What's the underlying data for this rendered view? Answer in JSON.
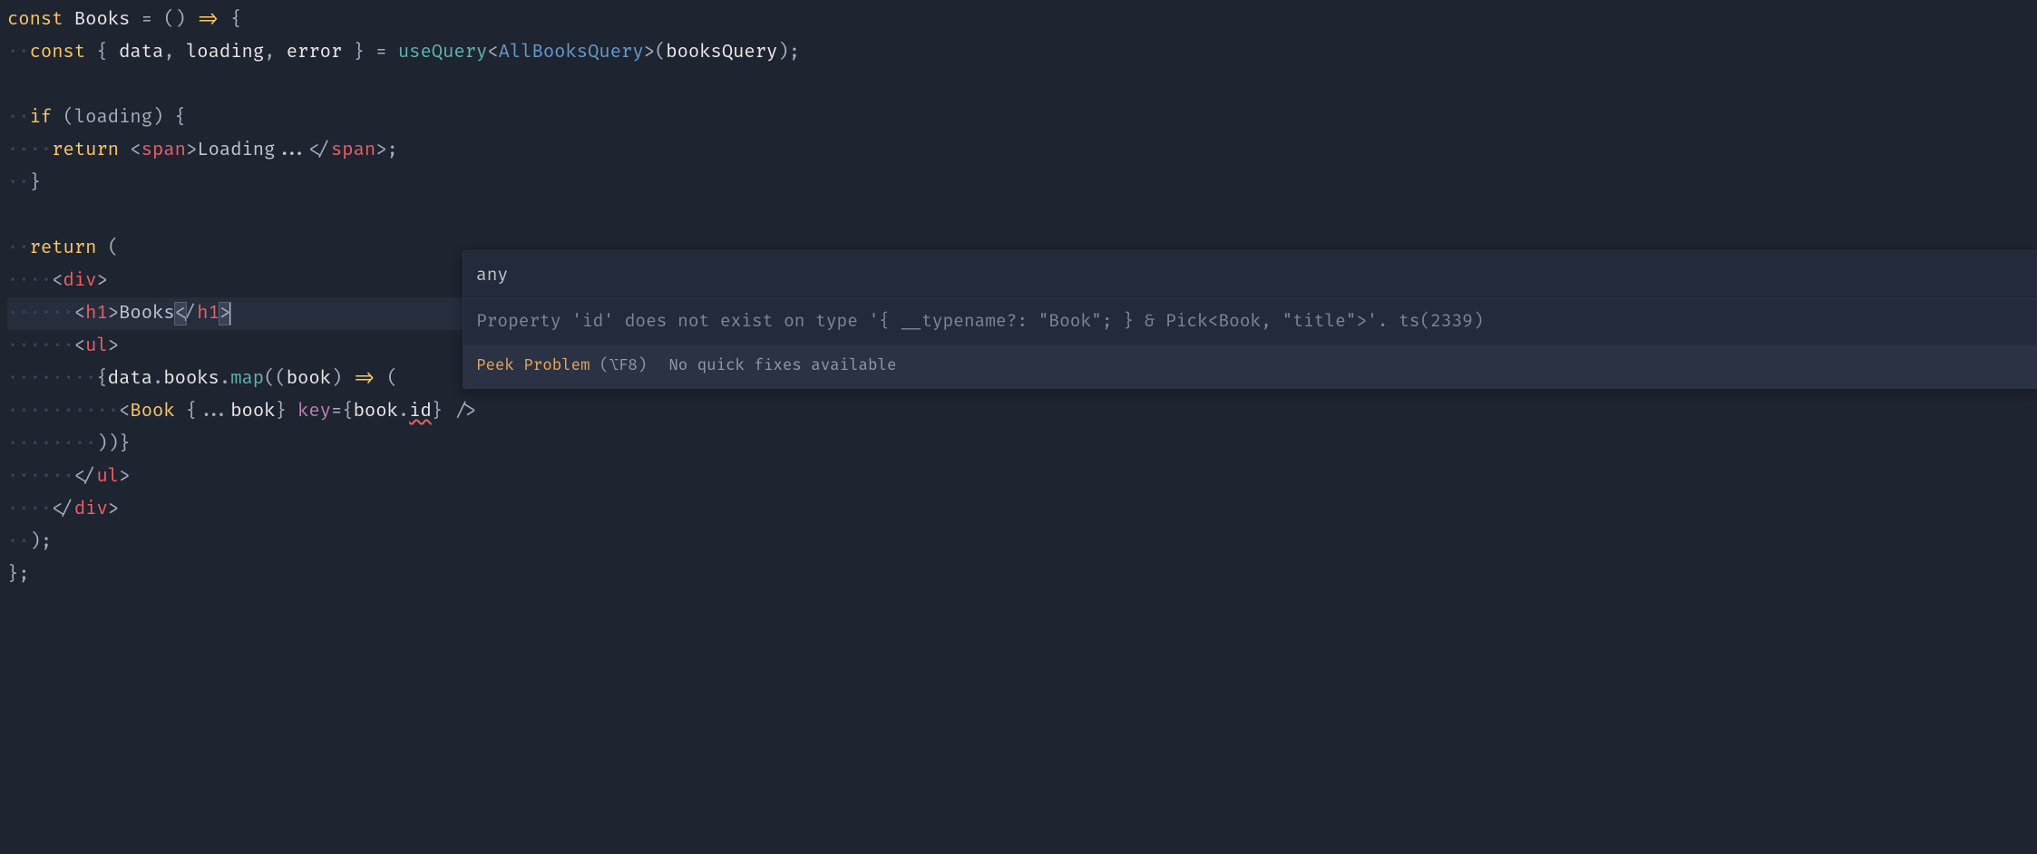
{
  "code": {
    "line1": {
      "const": "const",
      "name": "Books",
      "eq": " = ",
      "paren": "() ",
      "arrow": "=>",
      "brace": " {"
    },
    "line2": {
      "ws": "  ",
      "const": "const",
      "destr_open": " { ",
      "data": "data",
      "comma1": ", ",
      "loading": "loading",
      "comma2": ", ",
      "error": "error",
      "destr_close": " } ",
      "eq": "= ",
      "useQuery": "useQuery",
      "lt": "<",
      "type": "AllBooksQuery",
      "gt": ">",
      "paren_open": "(",
      "arg": "booksQuery",
      "paren_close": ")",
      "semi": ";"
    },
    "line4": {
      "ws": "  ",
      "if": "if",
      "cond": " (loading) {"
    },
    "line5": {
      "ws": "    ",
      "return": "return",
      "sp": " ",
      "tag_open": "<",
      "tag": "span",
      "tag_close": ">",
      "text": "Loading...",
      "end_open": "</",
      "end_tag": "span",
      "end_close": ">",
      "semi": ";"
    },
    "line6": {
      "ws": "  ",
      "brace": "}"
    },
    "line8": {
      "ws": "  ",
      "return": "return",
      "paren": " ("
    },
    "line9": {
      "ws": "    ",
      "open": "<",
      "tag": "div",
      "close": ">"
    },
    "line10": {
      "ws": "      ",
      "open": "<",
      "tag": "h1",
      "close": ">",
      "text": "Books",
      "end_open": "<",
      "slash": "/",
      "end_tag": "h1",
      "end_close": ">"
    },
    "line11": {
      "ws": "      ",
      "open": "<",
      "tag": "ul",
      "close": ">"
    },
    "line12": {
      "ws": "        ",
      "brace": "{",
      "data": "data",
      "dot1": ".",
      "books": "books",
      "dot2": ".",
      "map": "map",
      "paren_open": "((",
      "book": "book",
      "paren_close": ") ",
      "arrow": "=>",
      "paren": " ("
    },
    "line13": {
      "ws": "          ",
      "open": "<",
      "comp": "Book",
      "spread_open": " {",
      "spread": "...",
      "book": "book",
      "spread_close": "} ",
      "key": "key",
      "eq": "=",
      "brace_open": "{",
      "book2": "book",
      "dot": ".",
      "id": "id",
      "brace_close": "}",
      "self_close": " />"
    },
    "line14": {
      "ws": "        ",
      "close": "))}"
    },
    "line15": {
      "ws": "      ",
      "open": "</",
      "tag": "ul",
      "close": ">"
    },
    "line16": {
      "ws": "    ",
      "open": "</",
      "tag": "div",
      "close": ">"
    },
    "line17": {
      "ws": "  ",
      "paren": ");"
    },
    "line18": {
      "brace": "};"
    }
  },
  "hover": {
    "header": "any",
    "body": "Property 'id' does not exist on type '{ __typename?: \"Book\"; } & Pick<Book, \"title\">'. ts(2339)",
    "peek_label": "Peek Problem",
    "peek_shortcut": "(⌥F8)",
    "no_fix": "No quick fixes available"
  }
}
